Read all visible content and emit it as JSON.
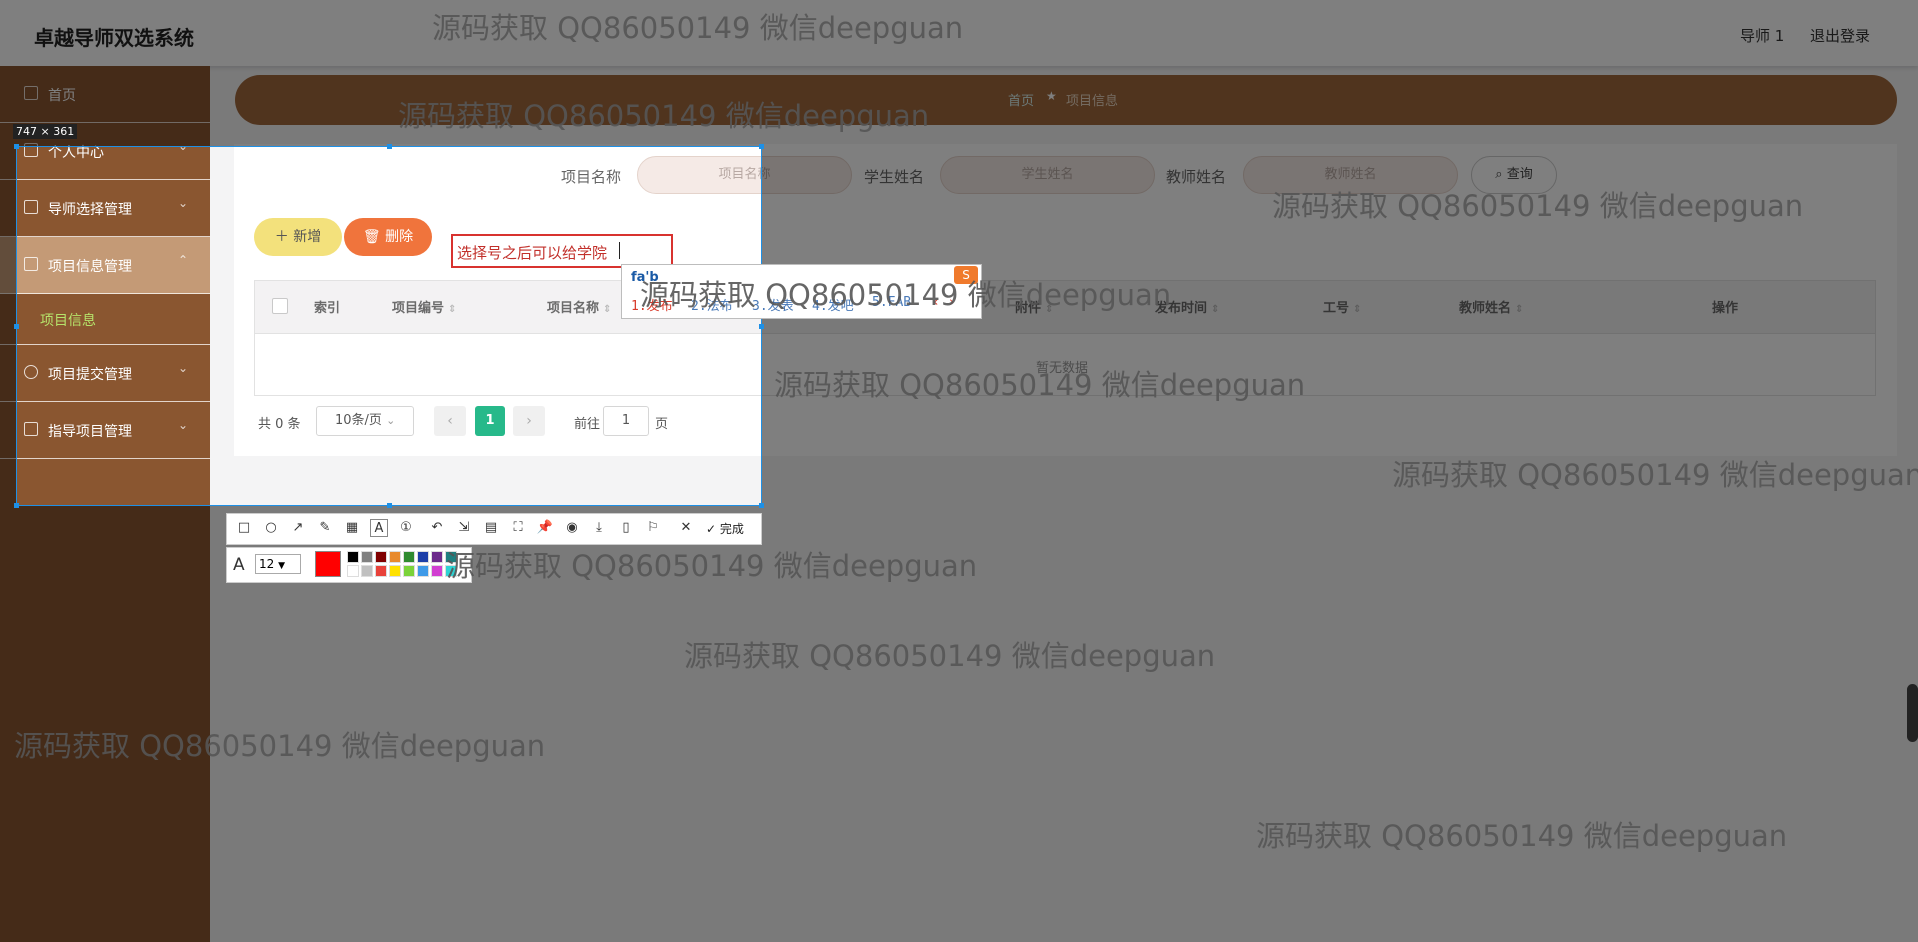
{
  "header": {
    "app_title": "卓越导师双选系统",
    "user": "导师 1",
    "logout": "退出登录"
  },
  "sidebar": {
    "items": [
      {
        "label": "首页"
      },
      {
        "label": "个人中心"
      },
      {
        "label": "导师选择管理"
      },
      {
        "label": "项目信息管理"
      },
      {
        "label": "项目提交管理"
      },
      {
        "label": "指导项目管理"
      }
    ],
    "active_sub": "项目信息"
  },
  "breadcrumb": {
    "home": "首页",
    "current": "项目信息"
  },
  "search": {
    "project_label": "项目名称",
    "project_placeholder": "项目名称",
    "student_label": "学生姓名",
    "student_placeholder": "学生姓名",
    "teacher_label": "教师姓名",
    "teacher_placeholder": "教师姓名",
    "button": "查询"
  },
  "actions": {
    "add": "新增",
    "delete": "删除"
  },
  "table": {
    "columns": [
      "索引",
      "项目编号",
      "项目名称",
      "附件",
      "发布时间",
      "工号",
      "教师姓名",
      "操作"
    ],
    "empty": "暂无数据"
  },
  "pagination": {
    "total": "共 0 条",
    "page_size": "10条/页",
    "current": "1",
    "goto": "前往",
    "goto_value": "1",
    "unit": "页"
  },
  "capture": {
    "size": "747 × 361",
    "annotation_text": "选择号之后可以给学院",
    "ime_composition": "fa'b",
    "ime_candidates": [
      "1.发布",
      "2.法布",
      "3.发表",
      "4.发吧",
      "5.FAB"
    ],
    "ime_logo": "S",
    "done_label": "完成",
    "font_size": "12",
    "current_color": "#ff0000"
  },
  "watermark": "源码获取 QQ86050149 微信deepguan"
}
